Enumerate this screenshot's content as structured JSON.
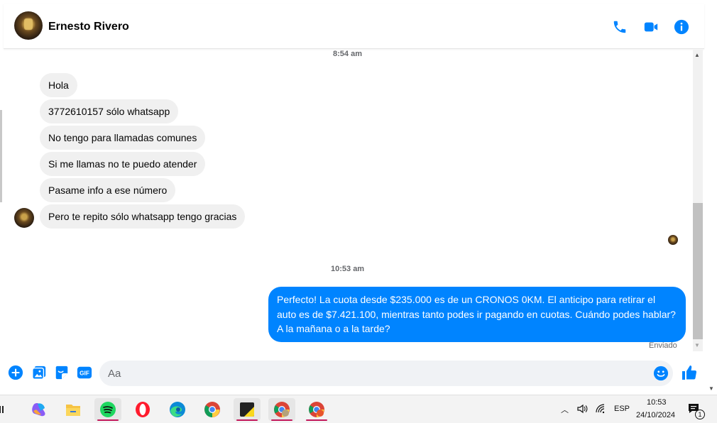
{
  "header": {
    "contact_name": "Ernesto Rivero"
  },
  "messages": {
    "time_1": "8:54 am",
    "incoming": [
      "Hola",
      "3772610157 sólo whatsapp",
      "No tengo para llamadas comunes",
      "Si me llamas no te puedo atender",
      "Pasame info a ese número",
      "Pero te repito sólo whatsapp tengo gracias"
    ],
    "time_2": "10:53 am",
    "outgoing": "Perfecto! La cuota desde $235.000 es de un CRONOS 0KM. El anticipo para retirar el auto es de $7.421.100, mientras tanto podes ir pagando en cuotas. Cuándo podes hablar? A la mañana o a la tarde?",
    "status": "Enviado"
  },
  "composer": {
    "placeholder": "Aa"
  },
  "taskbar": {
    "language": "ESP",
    "time": "10:53",
    "date": "24/10/2024",
    "notification_count": "1"
  },
  "colors": {
    "accent": "#0084ff",
    "bubble_in": "#f0f0f0",
    "text": "#050505",
    "muted": "#65676b"
  }
}
